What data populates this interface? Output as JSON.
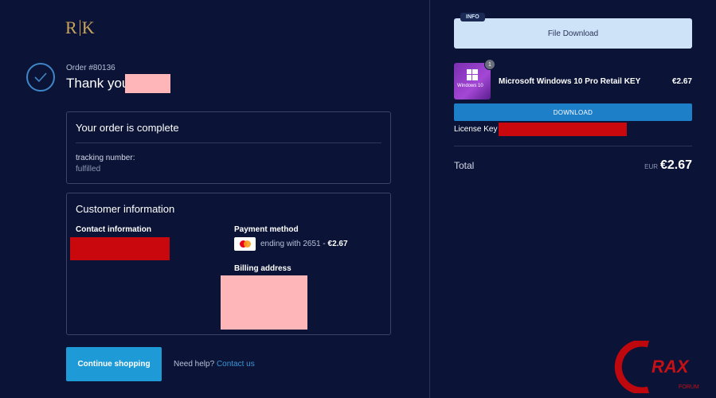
{
  "brand": {
    "logo_left": "R",
    "logo_right": "K"
  },
  "order": {
    "number": "Order #80136",
    "thank_you": "Thank you"
  },
  "status_card": {
    "title": "Your order is complete",
    "tracking_label": "tracking number:",
    "status": "fulfilled"
  },
  "customer_card": {
    "title": "Customer information",
    "contact_label": "Contact information",
    "payment_label": "Payment method",
    "payment_detail": "ending with 2651",
    "payment_sep": " - ",
    "payment_amount": "€2.67",
    "billing_label": "Billing address"
  },
  "actions": {
    "continue_label": "Continue shopping",
    "help_text": "Need help?",
    "contact_link": "Contact us"
  },
  "info_panel": {
    "tag": "INFO",
    "title": "File Download"
  },
  "product": {
    "quantity": "1",
    "name": "Microsoft Windows 10 Pro Retail KEY",
    "price": "€2.67",
    "image_text": "Windows 10",
    "download_label": "DOWNLOAD",
    "license_label": "License Key :"
  },
  "summary": {
    "total_label": "Total",
    "currency": "EUR",
    "total_value": "€2.67"
  },
  "watermark": {
    "text": "RAX",
    "sub": "FORUM"
  },
  "colors": {
    "background": "#0b1437",
    "accent": "#1e9bd7",
    "logo_gold": "#c9a45a",
    "redaction_red": "#c8080c",
    "redaction_pink": "#ffb6b9"
  },
  "icons": {
    "check": "check-circle-icon",
    "card": "mastercard-icon",
    "windows": "windows-logo-icon"
  }
}
